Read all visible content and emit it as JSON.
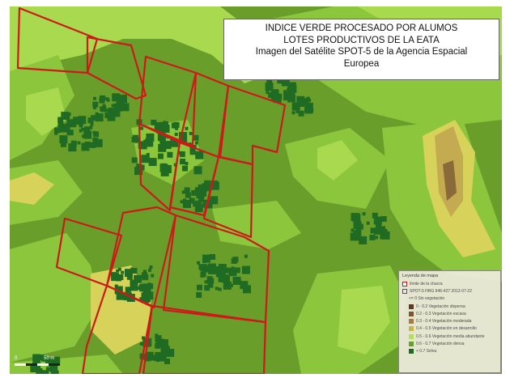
{
  "title": {
    "line1": "INDICE VERDE PROCESADO POR ALUMOS",
    "line2": "LOTES PRODUCTIVOS DE LA EATA",
    "line3": "Imagen del Satélite SPOT-5 de la Agencia Espacial",
    "line4": "Europea"
  },
  "legend": {
    "title": "Leyenda de mapa",
    "items": [
      {
        "label": "límite de la chacra",
        "swatch": "outline",
        "indent": false
      },
      {
        "label": "SPOT-5 HRG 646-427 2012-07-22",
        "swatch": "grid",
        "indent": false
      },
      {
        "label": "<= 0 Sin vegetación",
        "swatch": "none",
        "indent": true
      },
      {
        "label": "0 - 0.2  Vegetación dispersa",
        "swatch": "#5c3a22",
        "indent": true
      },
      {
        "label": "0.2 - 0.3  Vegetación escasa",
        "swatch": "#7a5530",
        "indent": true
      },
      {
        "label": "0.3 - 0.4  Vegetación moderada",
        "swatch": "#a27c44",
        "indent": true
      },
      {
        "label": "0.4 - 0.5  Vegetación en desarrollo",
        "swatch": "#c9b44c",
        "indent": true
      },
      {
        "label": "0.5 - 0.6  Vegetación media abundante",
        "swatch": "#b6dd5c",
        "indent": true
      },
      {
        "label": "0.6 - 0.7  Vegetación densa",
        "swatch": "#64a02e",
        "indent": true
      },
      {
        "label": "> 0.7  Selva",
        "swatch": "#1d6a23",
        "indent": true
      }
    ]
  },
  "scale_bar": {
    "label_start": "0",
    "label_end": "50 m"
  },
  "colors": {
    "base_green": "#6a9e2a",
    "light_green": "#8cc63c",
    "pale_green": "#a8d94e",
    "yellow": "#d6d25a",
    "tan": "#c4aa50",
    "brown": "#8a6a38",
    "dark_green": "#1f6b24",
    "lot_outline": "#cc1a1a"
  }
}
